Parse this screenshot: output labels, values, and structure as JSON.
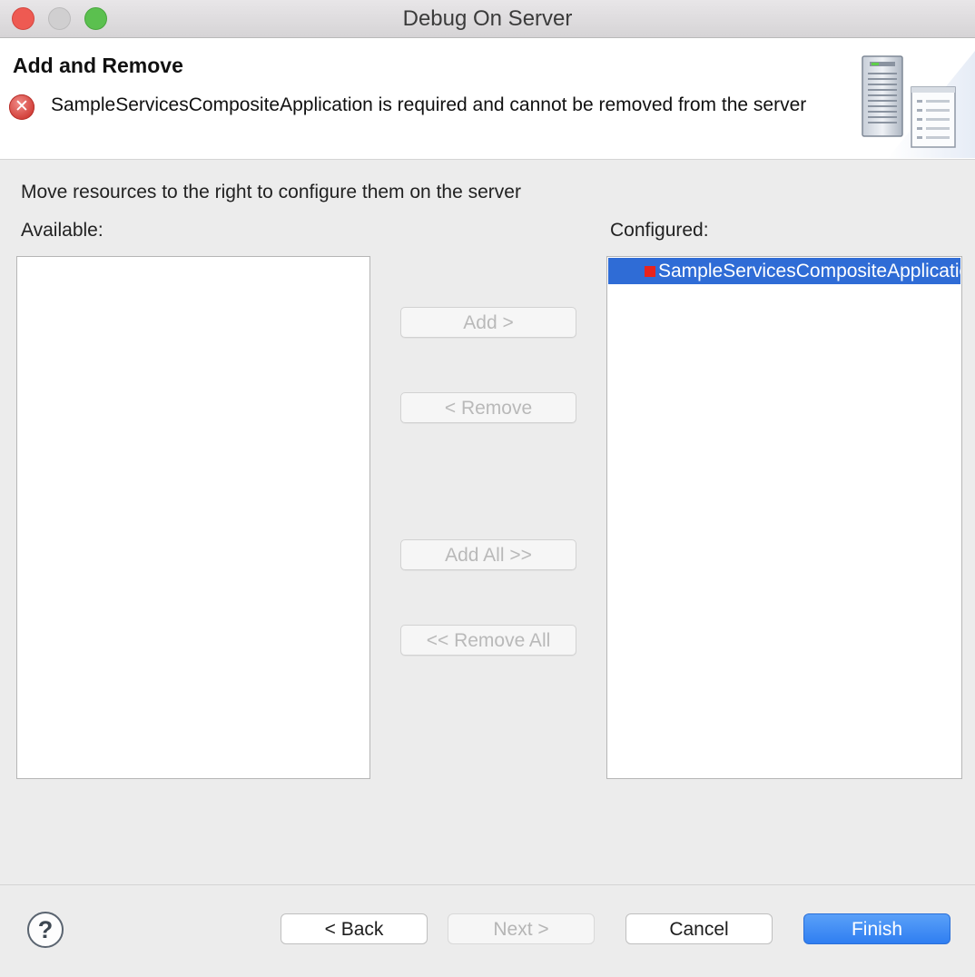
{
  "window": {
    "title": "Debug On Server"
  },
  "header": {
    "title": "Add and Remove",
    "error_icon_symbol": "✕",
    "error_message": "SampleServicesCompositeApplication is required and cannot be removed from the server"
  },
  "main": {
    "instruction": "Move resources to the right to configure them on the server",
    "available_label": "Available:",
    "configured_label": "Configured:",
    "available_items": [],
    "configured_items": [
      {
        "label": "SampleServicesCompositeApplication",
        "selected": true,
        "icon": "module-error-icon",
        "icon_color": "#e8231c"
      }
    ],
    "buttons": {
      "add": "Add >",
      "remove": "< Remove",
      "add_all": "Add All >>",
      "remove_all": "<< Remove All"
    }
  },
  "footer": {
    "help_symbol": "?",
    "back": "< Back",
    "next": "Next >",
    "cancel": "Cancel",
    "finish": "Finish"
  },
  "colors": {
    "selection": "#2f6cd6",
    "primary_button": "#2f7ef1",
    "error": "#d2403a"
  }
}
